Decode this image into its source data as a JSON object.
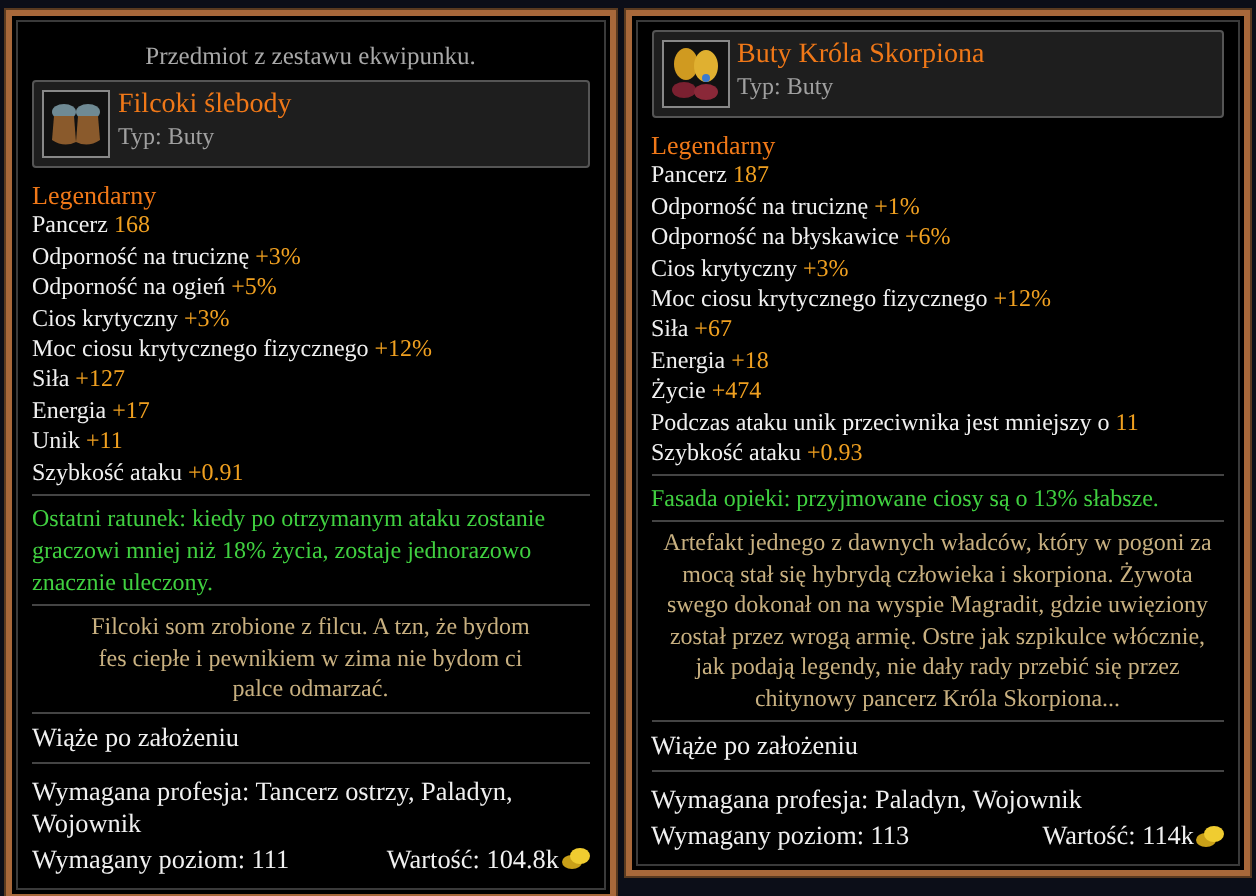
{
  "tooltips": [
    {
      "header": "Przedmiot z zestawu ekwipunku.",
      "kind": "felt",
      "name": "Filcoki ślebody",
      "type": "Typ: Buty",
      "rarity": "Legendarny",
      "stats": [
        {
          "label": "Pancerz",
          "value": "168"
        },
        {
          "label": "Odporność na truciznę",
          "value": "+3%"
        },
        {
          "label": "Odporność na ogień",
          "value": "+5%"
        },
        {
          "label": "Cios krytyczny",
          "value": "+3%"
        },
        {
          "label": "Moc ciosu krytycznego fizycznego",
          "value": "+12%"
        },
        {
          "label": "Siła",
          "value": "+127"
        },
        {
          "label": "Energia",
          "value": "+17"
        },
        {
          "label": "Unik",
          "value": "+11"
        },
        {
          "label": "Szybkość ataku",
          "value": "+0.91"
        }
      ],
      "bonus": "Ostatni ratunek: kiedy po otrzymanym ataku zostanie graczowi mniej niż 18% życia, zostaje jednorazowo znacznie uleczony.",
      "description": "Filcoki som zrobione z filcu. A tzn, że bydom fes ciepłe i pewnikiem w zima nie bydom ci palce odmarzać.",
      "binding": "Wiąże po założeniu",
      "profession": "Wymagana profesja: Tancerz ostrzy, Paladyn, Wojownik",
      "level": "Wymagany poziom: 111",
      "worth": "Wartość: 104.8k"
    },
    {
      "kind": "gold",
      "name": "Buty Króla Skorpiona",
      "type": "Typ: Buty",
      "rarity": "Legendarny",
      "stats": [
        {
          "label": "Pancerz",
          "value": "187"
        },
        {
          "label": "Odporność na truciznę",
          "value": "+1%"
        },
        {
          "label": "Odporność na błyskawice",
          "value": "+6%"
        },
        {
          "label": "Cios krytyczny",
          "value": "+3%"
        },
        {
          "label": "Moc ciosu krytycznego fizycznego",
          "value": "+12%"
        },
        {
          "label": "Siła",
          "value": "+67"
        },
        {
          "label": "Energia",
          "value": "+18"
        },
        {
          "label": "Życie",
          "value": "+474"
        },
        {
          "label": "Podczas ataku unik przeciwnika jest mniejszy o",
          "value": "11"
        },
        {
          "label": "Szybkość ataku",
          "value": "+0.93"
        }
      ],
      "bonus": "Fasada opieki: przyjmowane ciosy są o 13% słabsze.",
      "description": "Artefakt jednego z dawnych władców, który w pogoni za mocą stał się hybrydą człowieka i skorpiona. Żywota swego dokonał on na wyspie Magradit, gdzie uwięziony został przez wrogą armię. Ostre jak szpikulce włócznie, jak podają legendy, nie dały rady przebić się przez chitynowy pancerz Króla Skorpiona...",
      "binding": "Wiąże po założeniu",
      "profession": "Wymagana profesja: Paladyn, Wojownik",
      "level": "Wymagany poziom: 113",
      "worth": "Wartość: 114k"
    }
  ]
}
